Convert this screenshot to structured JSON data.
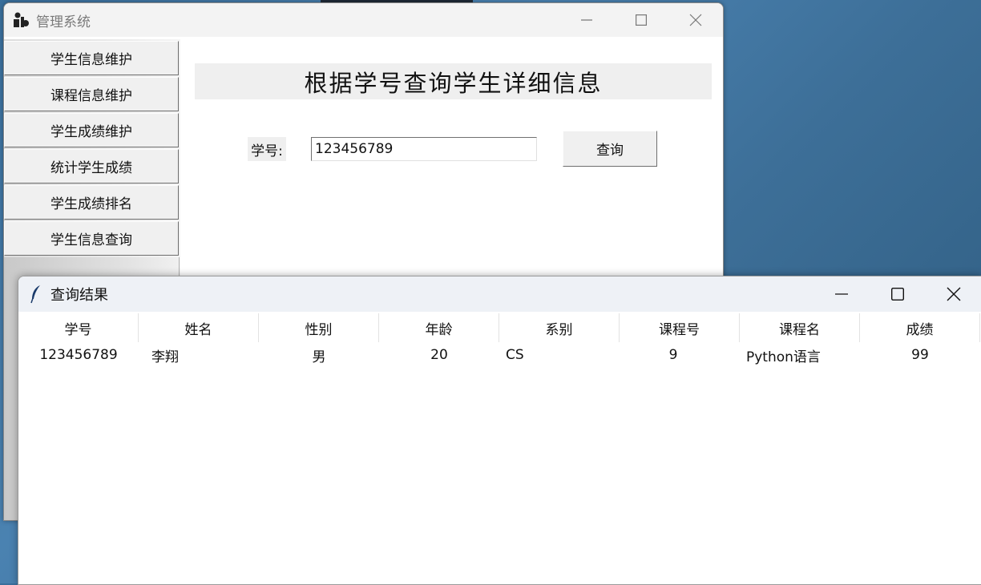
{
  "main_window": {
    "title": "管理系统",
    "sidebar": {
      "items": [
        {
          "label": "学生信息维护"
        },
        {
          "label": "课程信息维护"
        },
        {
          "label": "学生成绩维护"
        },
        {
          "label": "统计学生成绩"
        },
        {
          "label": "学生成绩排名"
        },
        {
          "label": "学生信息查询"
        }
      ]
    },
    "heading": "根据学号查询学生详细信息",
    "student_id_label": "学号:",
    "student_id_value": "123456789",
    "query_button": "查询"
  },
  "result_window": {
    "title": "查询结果",
    "columns": [
      "学号",
      "姓名",
      "性别",
      "年龄",
      "系别",
      "课程号",
      "课程名",
      "成绩"
    ],
    "rows": [
      [
        "123456789",
        "李翔",
        "男",
        "20",
        "CS",
        "9",
        "Python语言",
        "99"
      ]
    ]
  }
}
